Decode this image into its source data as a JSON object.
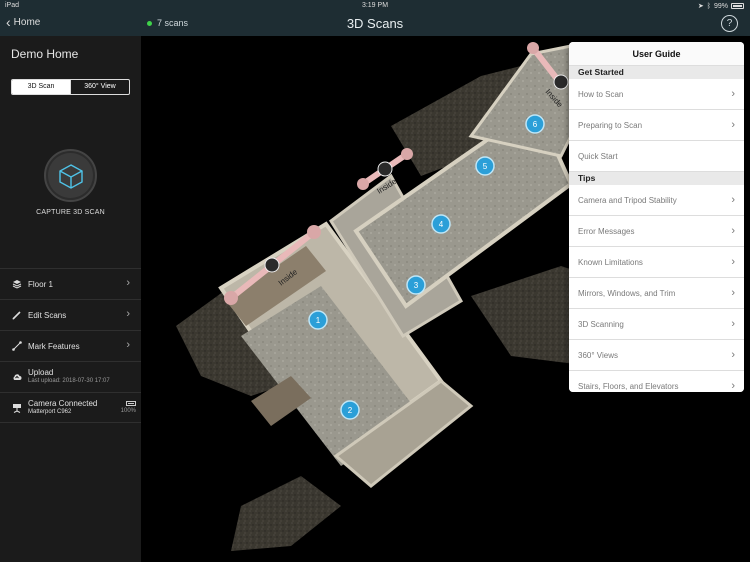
{
  "status_bar": {
    "device": "iPad",
    "time": "3:19 PM",
    "battery": "99%"
  },
  "nav": {
    "back_label": "Home",
    "scan_count": "7 scans",
    "title": "3D Scans",
    "help_label": "?"
  },
  "sidebar": {
    "home_name": "Demo Home",
    "tabs": [
      "3D Scan",
      "360° View"
    ],
    "capture_label": "CAPTURE 3D SCAN",
    "menu": [
      {
        "label": "Floor 1",
        "icon": "layers-icon"
      },
      {
        "label": "Edit Scans",
        "icon": "pencil-icon"
      },
      {
        "label": "Mark Features",
        "icon": "line-icon"
      }
    ],
    "upload": {
      "label": "Upload",
      "sub": "Last upload: 2018-07-30 17:07"
    },
    "camera": {
      "label": "Camera Connected",
      "sub": "Matterport C962",
      "battery": "100%"
    }
  },
  "map": {
    "scan_points": [
      "1",
      "2",
      "3",
      "4",
      "5",
      "6"
    ],
    "door_label": "Inside"
  },
  "guide": {
    "title": "User Guide",
    "sections": [
      {
        "heading": "Get Started",
        "items": [
          {
            "label": "How to Scan",
            "chevron": true
          },
          {
            "label": "Preparing to Scan",
            "chevron": true
          },
          {
            "label": "Quick Start",
            "chevron": false
          }
        ]
      },
      {
        "heading": "Tips",
        "items": [
          {
            "label": "Camera and Tripod Stability",
            "chevron": true
          },
          {
            "label": "Error Messages",
            "chevron": true
          },
          {
            "label": "Known Limitations",
            "chevron": true
          },
          {
            "label": "Mirrors, Windows, and Trim",
            "chevron": true
          },
          {
            "label": "3D Scanning",
            "chevron": true
          },
          {
            "label": "360° Views",
            "chevron": true
          },
          {
            "label": "Stairs, Floors, and Elevators",
            "chevron": true
          }
        ]
      }
    ]
  },
  "colors": {
    "accent_green": "#3fd24a",
    "scan_point_blue": "#2b9fd8",
    "nav_bg": "#1e2d33"
  }
}
